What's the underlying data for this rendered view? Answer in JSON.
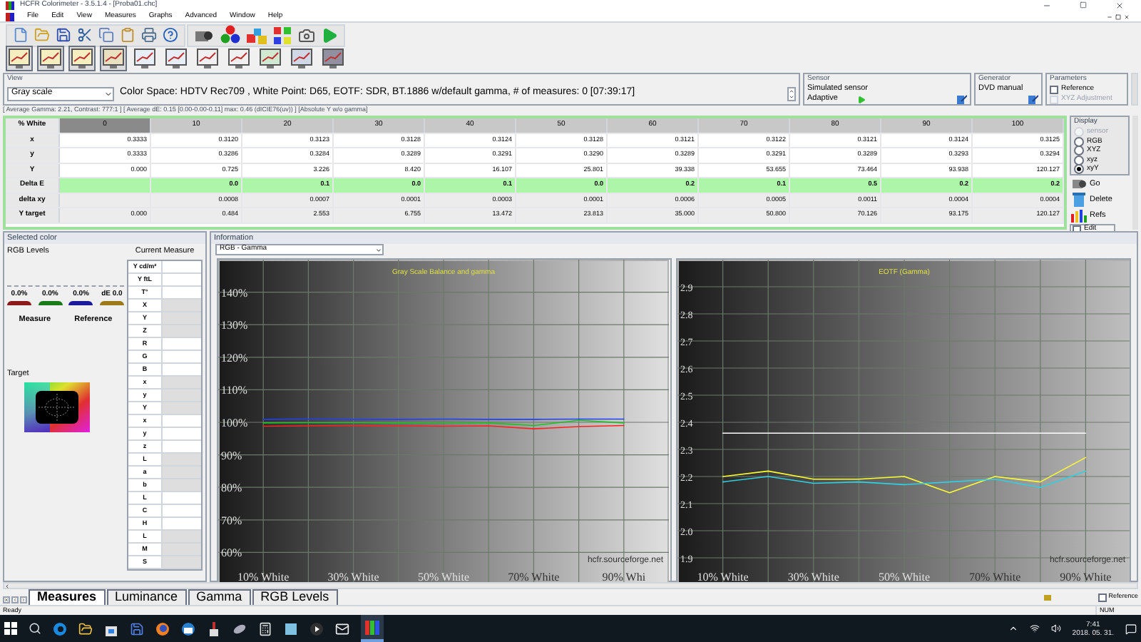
{
  "window": {
    "title": "HCFR Colorimeter - 3.5.1.4 - [Proba01.chc]"
  },
  "menu": [
    "File",
    "Edit",
    "View",
    "Measures",
    "Graphs",
    "Advanced",
    "Window",
    "Help"
  ],
  "view": {
    "label": "View",
    "mode": "Gray scale",
    "info": "Color Space: HDTV Rec709 , White Point: D65, EOTF:  SDR, BT.1886 w/default gamma, # of measures: 0 [07:39:17]"
  },
  "sensor": {
    "label": "Sensor",
    "name": "Simulated sensor",
    "mode": "Adaptive"
  },
  "generator": {
    "label": "Generator",
    "name": "DVD manual"
  },
  "parameters": {
    "label": "Parameters",
    "options": [
      {
        "label": "Reference",
        "checked": false,
        "disabled": false
      },
      {
        "label": "XYZ Adjustment",
        "checked": false,
        "disabled": true
      }
    ]
  },
  "stats": "[ Average Gamma: 2.21, Contrast: 777:1 ] [ Average dE: 0.15 [0.00-0.00-0.11] max: 0.46 (dICIE76(uv)) ] [Absolute Y w/o gamma]",
  "table": {
    "columns": [
      "% White",
      "0",
      "10",
      "20",
      "30",
      "40",
      "50",
      "60",
      "70",
      "80",
      "90",
      "100"
    ],
    "rows": [
      {
        "label": "x",
        "kind": "plain",
        "cells": [
          "0.3333",
          "0.3120",
          "0.3123",
          "0.3128",
          "0.3124",
          "0.3128",
          "0.3121",
          "0.3122",
          "0.3121",
          "0.3124",
          "0.3125"
        ]
      },
      {
        "label": "y",
        "kind": "plain",
        "cells": [
          "0.3333",
          "0.3286",
          "0.3284",
          "0.3289",
          "0.3291",
          "0.3290",
          "0.3289",
          "0.3291",
          "0.3289",
          "0.3293",
          "0.3294"
        ]
      },
      {
        "label": "Y",
        "kind": "plain",
        "cells": [
          "0.000",
          "0.725",
          "3.226",
          "8.420",
          "16.107",
          "25.801",
          "39.338",
          "53.655",
          "73.464",
          "93.938",
          "120.127"
        ]
      },
      {
        "label": "Delta E",
        "kind": "score",
        "cells": [
          "",
          "0.0",
          "0.1",
          "0.0",
          "0.1",
          "0.0",
          "0.2",
          "0.1",
          "0.5",
          "0.2",
          "0.2"
        ]
      },
      {
        "label": "delta xy",
        "kind": "derived",
        "cells": [
          "",
          "0.0008",
          "0.0007",
          "0.0001",
          "0.0003",
          "0.0001",
          "0.0006",
          "0.0005",
          "0.0011",
          "0.0004",
          "0.0004"
        ]
      },
      {
        "label": "Y target",
        "kind": "derived",
        "cells": [
          "0.000",
          "0.484",
          "2.553",
          "6.755",
          "13.472",
          "23.813",
          "35.000",
          "50.800",
          "70.126",
          "93.175",
          "120.127"
        ]
      }
    ]
  },
  "display": {
    "label": "Display",
    "options": [
      {
        "label": "sensor",
        "selected": false,
        "disabled": true
      },
      {
        "label": "RGB",
        "selected": false,
        "disabled": false
      },
      {
        "label": "XYZ",
        "selected": false,
        "disabled": false
      },
      {
        "label": "xyz",
        "selected": false,
        "disabled": false
      },
      {
        "label": "xyY",
        "selected": true,
        "disabled": false
      }
    ]
  },
  "actions": [
    {
      "label": "Go",
      "kind": "go"
    },
    {
      "label": "Delete",
      "kind": "delete"
    },
    {
      "label": "Refs",
      "kind": "refs"
    }
  ],
  "edit": {
    "label": "Edit",
    "checked": false
  },
  "selected_color": {
    "title": "Selected color",
    "levels_label": "RGB Levels",
    "current_label": "Current Measure",
    "levels": [
      {
        "text": "0.0%",
        "color": "#8b1a1a"
      },
      {
        "text": "0.0%",
        "color": "#1a7a1a"
      },
      {
        "text": "0.0%",
        "color": "#1a1a9b"
      },
      {
        "text": "dE 0.0",
        "color": "#9b7a1a"
      }
    ],
    "measure": "Measure",
    "reference": "Reference",
    "target": "Target",
    "measure_rows": [
      {
        "label": "Y cd/m²",
        "shaded": false
      },
      {
        "label": "Y ftL",
        "shaded": false
      },
      {
        "label": "T°",
        "shaded": false
      },
      {
        "label": "X",
        "shaded": true
      },
      {
        "label": "Y",
        "shaded": true
      },
      {
        "label": "Z",
        "shaded": true
      },
      {
        "label": "R",
        "shaded": false
      },
      {
        "label": "G",
        "shaded": false
      },
      {
        "label": "B",
        "shaded": false
      },
      {
        "label": "x",
        "shaded": true
      },
      {
        "label": "y",
        "shaded": true
      },
      {
        "label": "Y",
        "shaded": true
      },
      {
        "label": "x",
        "shaded": false
      },
      {
        "label": "y",
        "shaded": false
      },
      {
        "label": "z",
        "shaded": false
      },
      {
        "label": "L",
        "shaded": true
      },
      {
        "label": "a",
        "shaded": true
      },
      {
        "label": "b",
        "shaded": true
      },
      {
        "label": "L",
        "shaded": false
      },
      {
        "label": "C",
        "shaded": false
      },
      {
        "label": "H",
        "shaded": false
      },
      {
        "label": "L",
        "shaded": true
      },
      {
        "label": "M",
        "shaded": true
      },
      {
        "label": "S",
        "shaded": true
      }
    ]
  },
  "information": {
    "title": "Information",
    "graph": "RGB - Gamma",
    "charts": [
      {
        "watermark": "hcfr.sourceforge.net",
        "chart_data": {
          "type": "line",
          "title": "Gray Scale Balance and gamma",
          "grid": true,
          "xlim": [
            0,
            100
          ],
          "ylim": [
            50,
            150
          ],
          "x": [
            10,
            20,
            30,
            40,
            50,
            60,
            70,
            80,
            90
          ],
          "yticks": [
            {
              "value": 60,
              "label": "60%"
            },
            {
              "value": 70,
              "label": "70%"
            },
            {
              "value": 80,
              "label": "80%"
            },
            {
              "value": 90,
              "label": "90%"
            },
            {
              "value": 100,
              "label": "100%"
            },
            {
              "value": 110,
              "label": "110%"
            },
            {
              "value": 120,
              "label": "120%"
            },
            {
              "value": 130,
              "label": "130%"
            },
            {
              "value": 140,
              "label": "140%"
            }
          ],
          "xticks": [
            {
              "value": 10,
              "label": "10% White"
            },
            {
              "value": 30,
              "label": "30% White"
            },
            {
              "value": 50,
              "label": "50% White"
            },
            {
              "value": 70,
              "label": "70% White"
            },
            {
              "value": 90,
              "label": "90% Whi"
            }
          ],
          "series": [
            {
              "color": "#ff2020",
              "values": [
                98.8,
                98.9,
                99.0,
                98.9,
                98.8,
                98.9,
                98.0,
                98.7,
                99.0
              ]
            },
            {
              "color": "#20c020",
              "values": [
                99.8,
                99.9,
                99.9,
                99.8,
                99.9,
                99.8,
                99.0,
                100.6,
                99.8
              ]
            },
            {
              "color": "#2040ff",
              "values": [
                100.9,
                101.0,
                100.9,
                100.9,
                101.0,
                100.9,
                100.9,
                101.0,
                101.0
              ]
            }
          ]
        }
      },
      {
        "watermark": "hcfr.sourceforge.net",
        "chart_data": {
          "type": "line",
          "title": "EOTF (Gamma)",
          "grid": true,
          "xlim": [
            0,
            100
          ],
          "ylim": [
            1.8,
            3.0
          ],
          "x": [
            10,
            20,
            30,
            40,
            50,
            60,
            70,
            80,
            90
          ],
          "yticks": [
            {
              "value": 1.9,
              "label": "1.9"
            },
            {
              "value": 2.0,
              "label": "2.0"
            },
            {
              "value": 2.1,
              "label": "2.1"
            },
            {
              "value": 2.2,
              "label": "2.2"
            },
            {
              "value": 2.3,
              "label": "2.3"
            },
            {
              "value": 2.4,
              "label": "2.4"
            },
            {
              "value": 2.5,
              "label": "2.5"
            },
            {
              "value": 2.6,
              "label": "2.6"
            },
            {
              "value": 2.7,
              "label": "2.7"
            },
            {
              "value": 2.8,
              "label": "2.8"
            },
            {
              "value": 2.9,
              "label": "2.9"
            }
          ],
          "xticks": [
            {
              "value": 10,
              "label": "10% White"
            },
            {
              "value": 30,
              "label": "30% White"
            },
            {
              "value": 50,
              "label": "50% White"
            },
            {
              "value": 70,
              "label": "70% White"
            },
            {
              "value": 90,
              "label": "90% White"
            }
          ],
          "series": [
            {
              "color": "#ffffff",
              "values": [
                2.36,
                2.36,
                2.36,
                2.36,
                2.36,
                2.36,
                2.36,
                2.36,
                2.36
              ]
            },
            {
              "color": "#ffff30",
              "values": [
                2.2,
                2.22,
                2.19,
                2.19,
                2.2,
                2.14,
                2.2,
                2.18,
                2.27
              ]
            },
            {
              "color": "#30d0e0",
              "values": [
                2.18,
                2.2,
                2.175,
                2.18,
                2.17,
                2.18,
                2.19,
                2.16,
                2.22
              ]
            }
          ]
        }
      }
    ]
  },
  "tabs": [
    {
      "label": "Measures",
      "selected": true
    },
    {
      "label": "Luminance",
      "selected": false
    },
    {
      "label": "Gamma",
      "selected": false
    },
    {
      "label": "RGB Levels",
      "selected": false
    }
  ],
  "reference": {
    "label": "Reference",
    "checked": false
  },
  "status_bar": {
    "text": "Ready",
    "indicator": "NUM"
  },
  "taskbar": {
    "time": "7:41",
    "date": "2018. 05. 31."
  }
}
